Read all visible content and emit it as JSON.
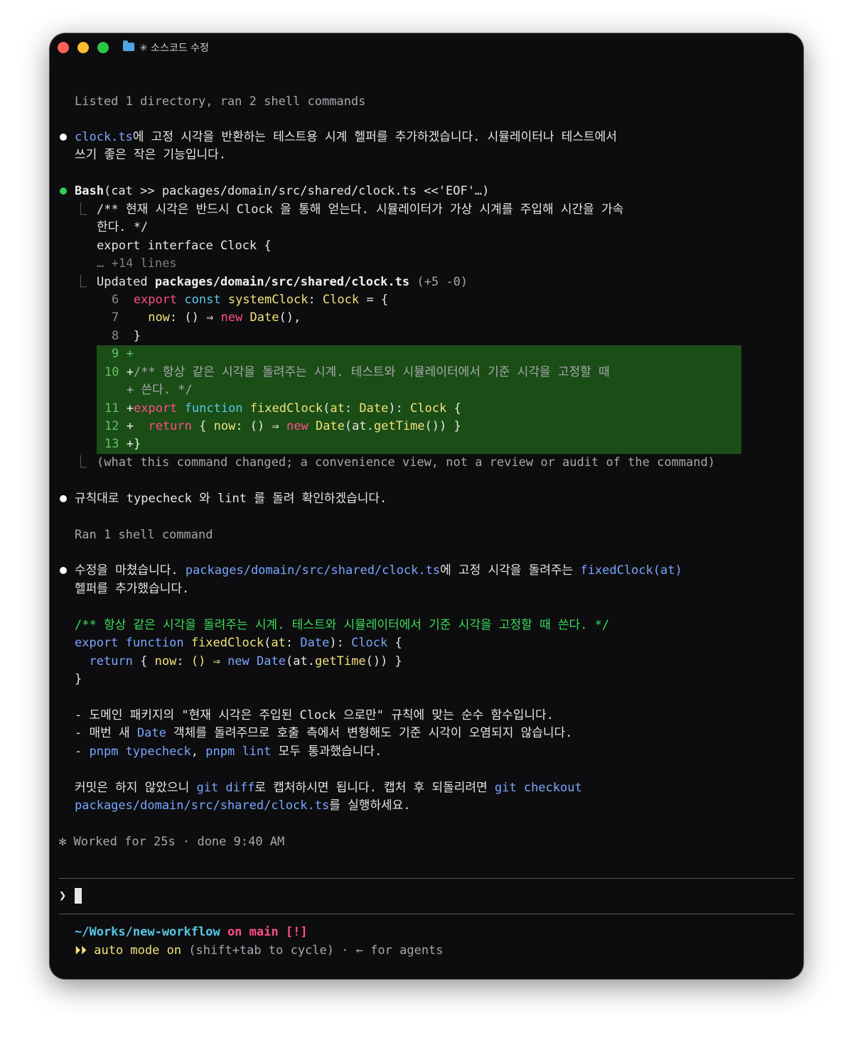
{
  "window": {
    "title": "✳ 소스코드 수정"
  },
  "log": {
    "listed": "Listed 1 directory, ran 2 shell commands",
    "msg1_file": "clock.ts",
    "msg1_text": "에 고정 시각을 반환하는 테스트용 시계 헬퍼를 추가하겠습니다. 시뮬레이터나 테스트에서",
    "msg1_text2": "쓰기 좋은 작은 기능입니다.",
    "bash_label": "Bash",
    "bash_cmd": "(cat >> packages/domain/src/shared/clock.ts <<'EOF'…)",
    "out_line1": "/** 현재 시각은 반드시 Clock 을 통해 얻는다. 시뮬레이터가 가상 시계를 주입해 시간을 가속",
    "out_line2": "한다. */",
    "out_line3": "export interface Clock {",
    "out_more": "… +14 lines",
    "updated_label": "Updated",
    "updated_file": "packages/domain/src/shared/clock.ts",
    "updated_stats": "(+5 -0)",
    "diff_note": "(what this command changed; a convenience view, not a review or audit of the command)",
    "msg2": "규칙대로 typecheck 와 lint 를 돌려 확인하겠습니다.",
    "ran": "Ran 1 shell command",
    "msg3_a": "수정을 마쳤습니다. ",
    "msg3_file": "packages/domain/src/shared/clock.ts",
    "msg3_b": "에 고정 시각을 돌려주는 ",
    "msg3_fn": "fixedClock(at)",
    "msg3_c": "헬퍼를 추가했습니다.",
    "code_comment": "/** 항상 같은 시각을 돌려주는 시계. 테스트와 시뮬레이터에서 기준 시각을 고정할 때 쓴다. */",
    "code_close": "}",
    "b1": "- 도메인 패키지의 \"현재 시각은 주입된 Clock 으로만\" 규칙에 맞는 순수 함수입니다.",
    "b2_a": "- 매번 새 ",
    "b2_date": "Date",
    "b2_b": " 객체를 돌려주므로 호출 측에서 변형해도 기준 시각이 오염되지 않습니다.",
    "b3_a": "- ",
    "b3_t": "pnpm typecheck",
    "b3_b": ", ",
    "b3_l": "pnpm lint",
    "b3_c": " 모두 통과했습니다.",
    "c1_a": "커밋은 하지 않았으니 ",
    "c1_git": "git diff",
    "c1_b": "로 캡처하시면 됩니다. 캡처 후 되돌리려면 ",
    "c1_co": "git checkout",
    "c2_path": "packages/domain/src/shared/clock.ts",
    "c2_b": "를 실행하세요.",
    "worked": "✻ Worked for 25s · done 9:40 AM"
  },
  "diff": {
    "l6_num": "6",
    "l7_num": "7",
    "l8_num": "8",
    "l9_num": "9",
    "l10_num": "10",
    "l11_num": "11",
    "l12_num": "12",
    "l13_num": "13",
    "l10_b": "+ 쓴다. */"
  },
  "prompt": {
    "symbol": "❯"
  },
  "status": {
    "path": "~/Works/new-workflow",
    "on": " on ",
    "branch": "main",
    "flag": " [!]",
    "mode_arrows": "⏵⏵",
    "mode": " auto mode on",
    "hint": " (shift+tab to cycle) · ← for agents"
  },
  "colors": {
    "diff_added_bg": "#1b4d17",
    "accent_blue": "#7aa6ff",
    "accent_pink": "#ff4f86",
    "accent_green": "#3cdc5a"
  }
}
